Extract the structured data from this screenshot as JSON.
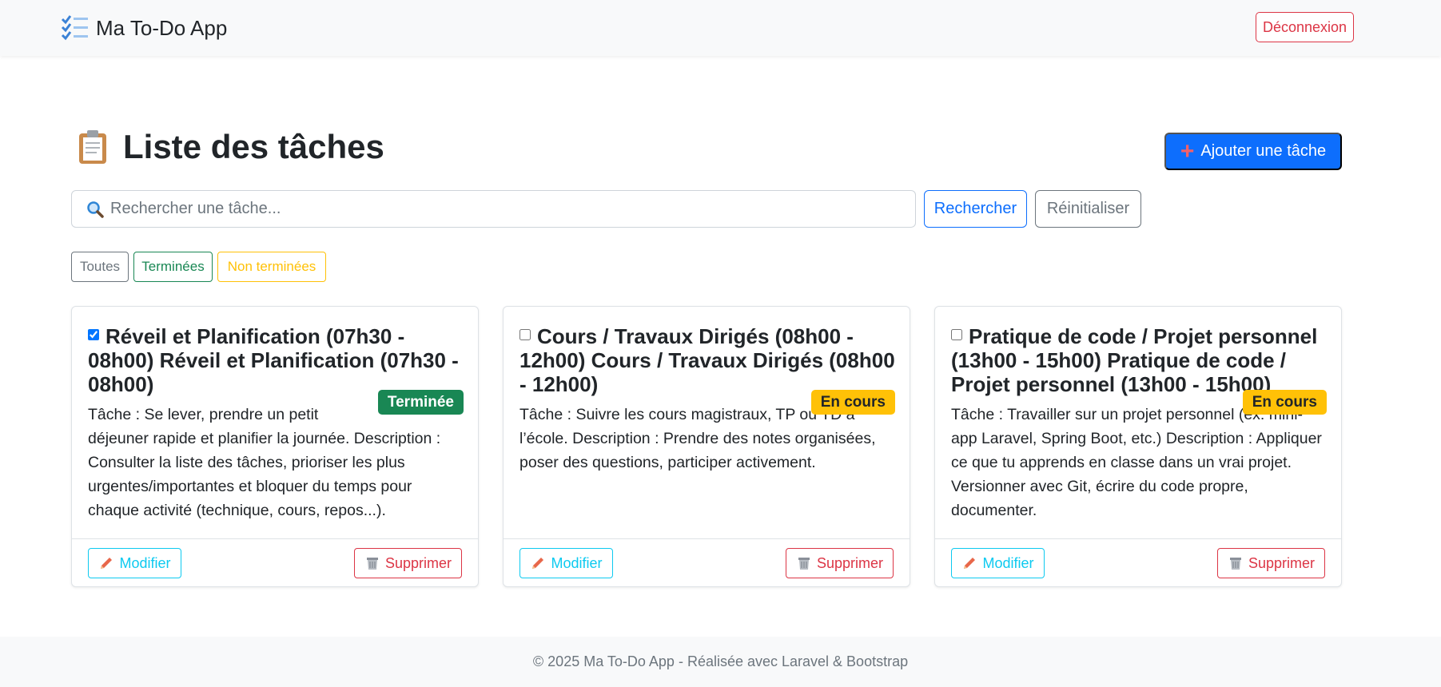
{
  "navbar": {
    "brand_icon": "checklist-icon",
    "brand": "Ma To-Do App",
    "logout_label": "Déconnexion"
  },
  "header": {
    "title_icon": "clipboard-icon",
    "title": "Liste des tâches",
    "add_icon": "plus-icon",
    "add_label": "Ajouter une tâche"
  },
  "search": {
    "icon": "search-icon",
    "placeholder": "Rechercher une tâche...",
    "value": "",
    "search_label": "Rechercher",
    "reset_label": "Réinitialiser"
  },
  "filters": [
    {
      "label": "Toutes"
    },
    {
      "label": "Terminées"
    },
    {
      "label": "Non terminées"
    }
  ],
  "tasks": [
    {
      "checked": true,
      "title": "Réveil et Planification (07h30 - 08h00) Réveil et Planification (07h30 - 08h00)",
      "status": "Terminée",
      "description": "Tâche : Se lever, prendre un petit déjeuner rapide et planifier la journée. Description : Consulter la liste des tâches, prioriser les plus urgentes/importantes et bloquer du temps pour chaque activité (technique, cours, repos...).",
      "edit_label": "Modifier",
      "delete_label": "Supprimer"
    },
    {
      "checked": false,
      "title": "Cours / Travaux Dirigés (08h00 - 12h00) Cours / Travaux Dirigés (08h00 - 12h00)",
      "status": "En cours",
      "description": "Tâche : Suivre les cours magistraux, TP ou TD à l’école. Description : Prendre des notes organisées, poser des questions, participer activement.",
      "edit_label": "Modifier",
      "delete_label": "Supprimer"
    },
    {
      "checked": false,
      "title": "Pratique de code / Projet personnel (13h00 - 15h00) Pratique de code / Projet personnel (13h00 - 15h00)",
      "status": "En cours",
      "description": "Tâche : Travailler sur un projet personnel (ex: mini-app Laravel, Spring Boot, etc.) Description : Appliquer ce que tu apprends en classe dans un vrai projet. Versionner avec Git, écrire du code propre, documenter.",
      "edit_label": "Modifier",
      "delete_label": "Supprimer"
    }
  ],
  "footer": {
    "text": "© 2025 Ma To-Do App - Réalisée avec Laravel & Bootstrap"
  },
  "colors": {
    "primary": "#0d6efd",
    "success": "#198754",
    "warning": "#ffc107",
    "danger": "#dc3545",
    "info": "#0dcaf0",
    "secondary": "#6c757d"
  }
}
